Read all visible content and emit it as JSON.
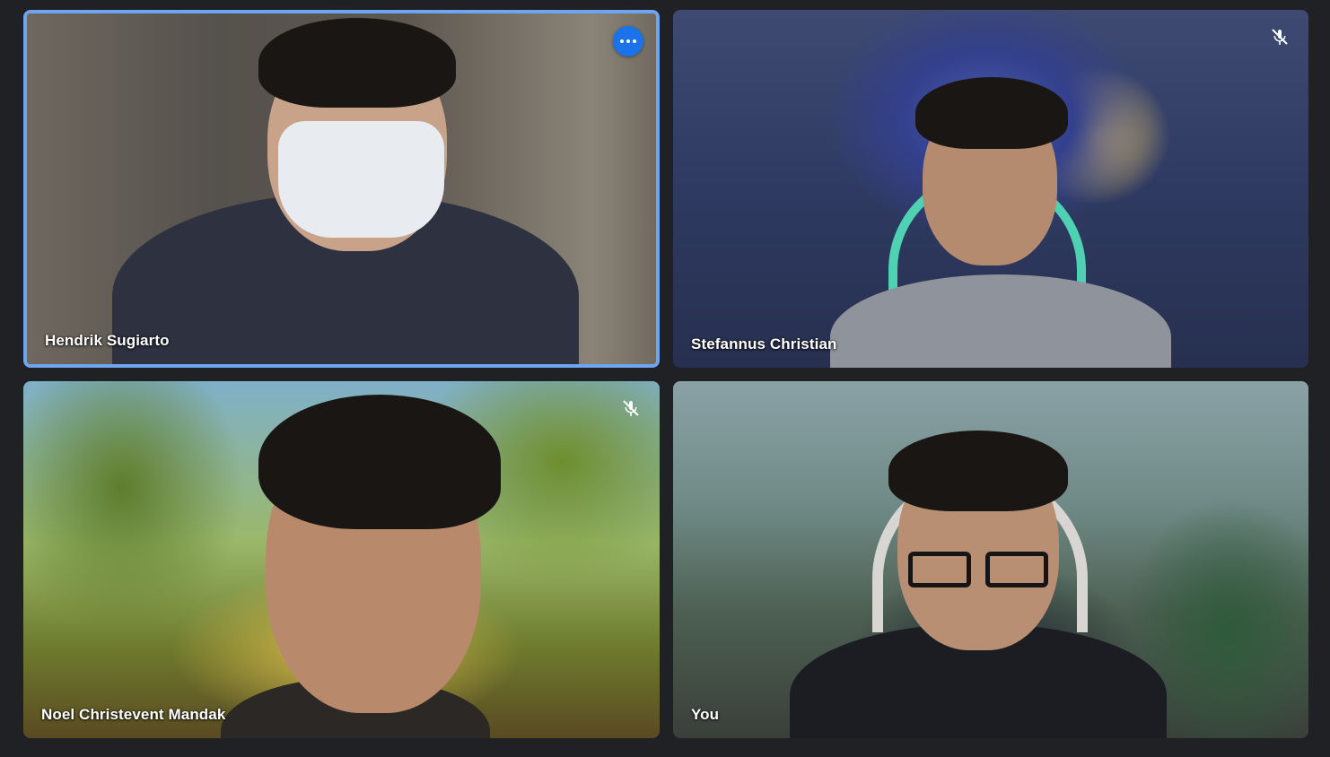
{
  "meeting": {
    "participants": [
      {
        "name": "Hendrik Sugiarto",
        "muted": false,
        "pinned_highlight": true,
        "has_more_options": true,
        "more_options_icon": "more-horiz-icon"
      },
      {
        "name": "Stefannus Christian",
        "muted": true,
        "mute_icon": "mic-off-icon"
      },
      {
        "name": "Noel Christevent Mandak",
        "muted": true,
        "mute_icon": "mic-off-icon"
      },
      {
        "name": "You",
        "muted": false
      }
    ]
  },
  "colors": {
    "background": "#202124",
    "active_speaker_border": "#6fa4f0",
    "more_button": "#1a73e8",
    "name_text": "#ffffff"
  }
}
